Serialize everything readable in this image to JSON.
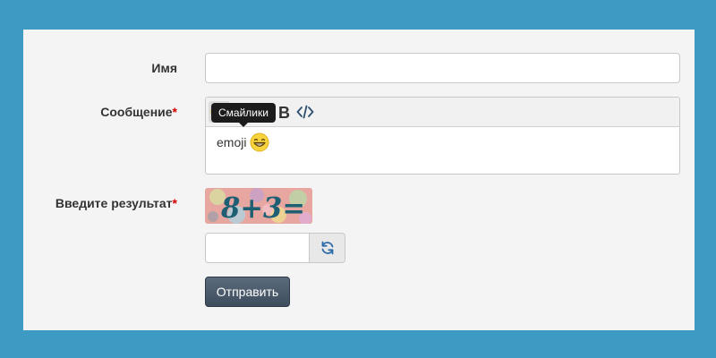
{
  "form": {
    "name_label": "Имя",
    "name_value": "",
    "message_label": "Сообщение",
    "message_required": "*",
    "captcha_label": "Введите результат",
    "captcha_required": "*",
    "captcha_expression": "8+3=",
    "captcha_value": "",
    "submit_label": "Отправить"
  },
  "editor": {
    "tooltip": "Смайлики",
    "content_text": "emoji",
    "toolbar": [
      {
        "name": "smiley-icon",
        "active": true
      },
      {
        "name": "quote-icon",
        "active": false
      },
      {
        "name": "image-icon",
        "active": false
      },
      {
        "name": "bold-icon",
        "active": false
      },
      {
        "name": "code-icon",
        "active": false
      }
    ],
    "content_emoji": "grinning-face-icon"
  },
  "colors": {
    "page_bg": "#3d9bc3",
    "panel_bg": "#f4f4f4",
    "required": "#d40000",
    "submit_bg": "#4a5a6b",
    "tooltip_bg": "#1c1c1c"
  }
}
